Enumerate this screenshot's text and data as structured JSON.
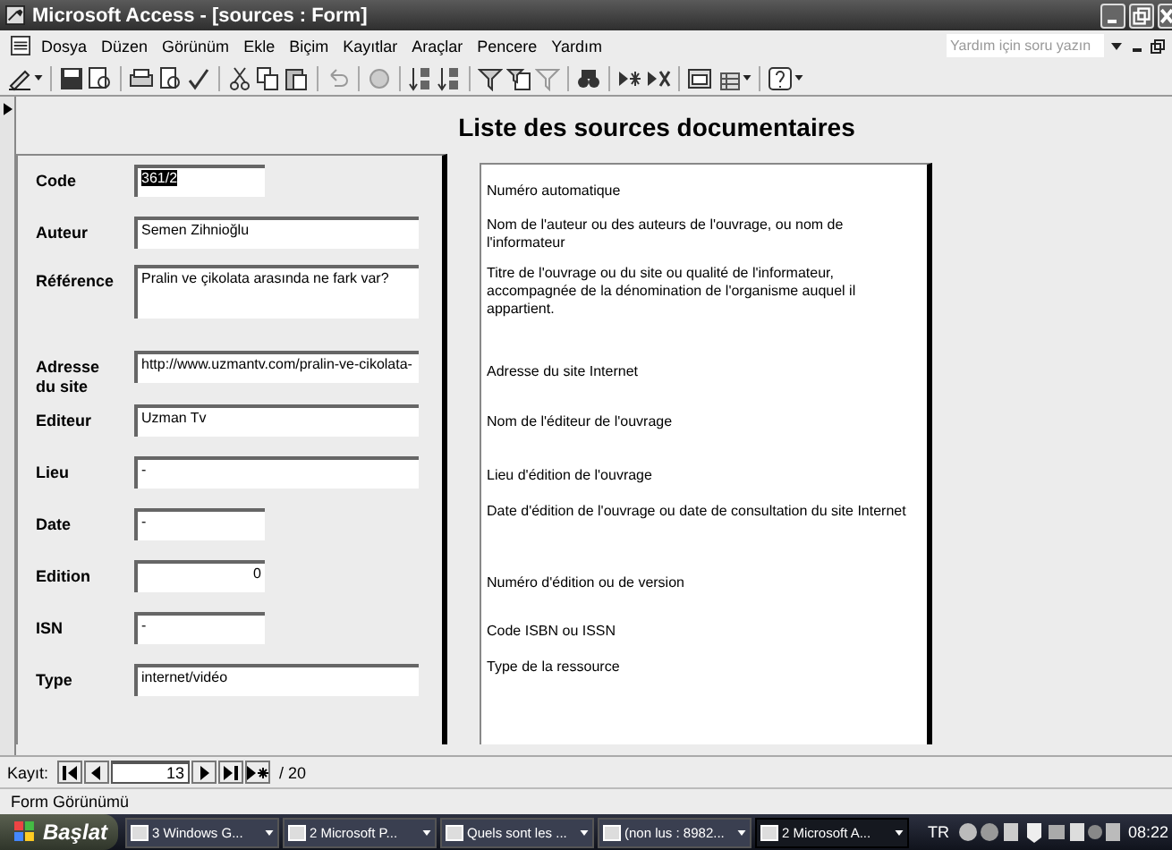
{
  "window": {
    "title": "Microsoft Access - [sources : Form]"
  },
  "menu": {
    "items": [
      "Dosya",
      "Düzen",
      "Görünüm",
      "Ekle",
      "Biçim",
      "Kayıtlar",
      "Araçlar",
      "Pencere",
      "Yardım"
    ],
    "help_box": {
      "placeholder": "Yardım için soru yazın"
    }
  },
  "form": {
    "title": "Liste des sources documentaires",
    "fields": [
      {
        "label": "Code",
        "value": "361/2",
        "selected": true
      },
      {
        "label": "Auteur",
        "value": "Semen Zihnioğlu",
        "selected": false
      },
      {
        "label": "Référence",
        "value": "Pralin ve çikolata arasında ne fark var?",
        "selected": false
      },
      {
        "label": "Adresse du site",
        "value": "http://www.uzmantv.com/pralin-ve-cikolata-",
        "selected": false
      },
      {
        "label": "Editeur",
        "value": "Uzman Tv",
        "selected": false
      },
      {
        "label": "Lieu",
        "value": "-",
        "selected": false
      },
      {
        "label": "Date",
        "value": "-",
        "selected": false
      },
      {
        "label": "Edition",
        "value": "0",
        "selected": false
      },
      {
        "label": "ISN",
        "value": "-",
        "selected": false
      },
      {
        "label": "Type",
        "value": "internet/vidéo",
        "selected": false
      }
    ],
    "descriptions": [
      "Numéro automatique",
      "Nom de l'auteur ou des auteurs de l'ouvrage, ou nom de l'informateur",
      "Titre de l'ouvrage ou du site ou qualité de l'informateur, accompagnée de la dénomination de l'organisme auquel il appartient.",
      "Adresse du site Internet",
      "Nom de l'éditeur de l'ouvrage",
      "Lieu d'édition de l'ouvrage",
      "Date d'édition de l'ouvrage ou date de consultation du site Internet",
      "Numéro d'édition ou de version",
      "Code ISBN ou ISSN",
      "Type de la ressource"
    ]
  },
  "record_nav": {
    "label": "Kayıt:",
    "current": "13",
    "total": "/ 20"
  },
  "status_bar": {
    "text": "Form Görünümü"
  },
  "taskbar": {
    "start": "Başlat",
    "tasks": [
      {
        "label": "3 Windows G...",
        "selected": false
      },
      {
        "label": "2 Microsoft P...",
        "selected": false
      },
      {
        "label": "Quels sont les ...",
        "selected": false
      },
      {
        "label": "(non lus : 8982...",
        "selected": false
      },
      {
        "label": "2 Microsoft A...",
        "selected": true
      }
    ],
    "language": "TR",
    "clock": "08:22"
  }
}
